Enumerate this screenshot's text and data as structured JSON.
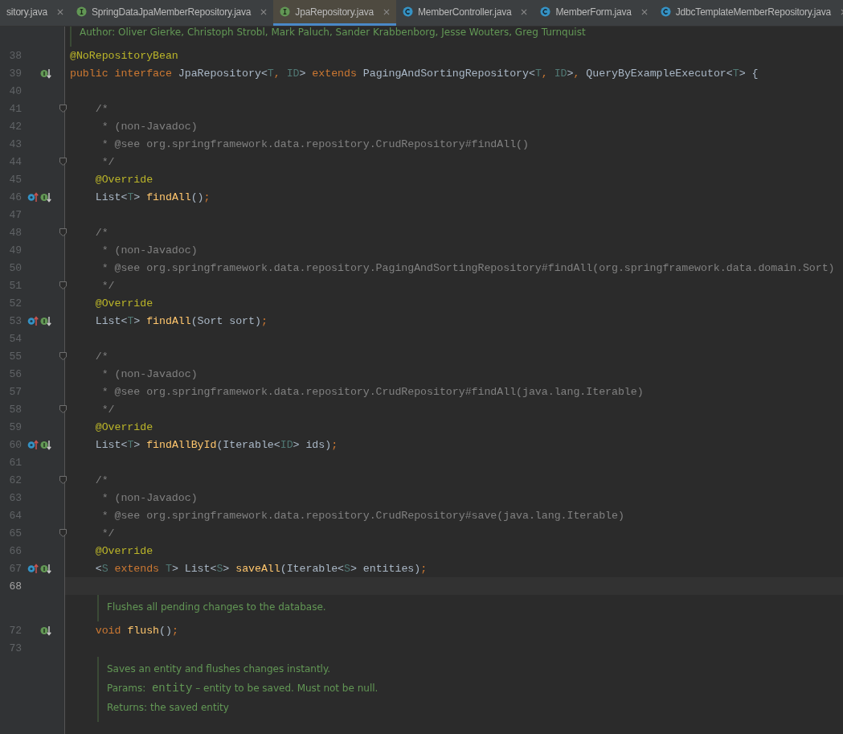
{
  "tabs": [
    {
      "label": "sitory.java",
      "selected": false
    },
    {
      "label": "SpringDataJpaMemberRepository.java",
      "kind": "interface",
      "selected": false
    },
    {
      "label": "JpaRepository.java",
      "kind": "interface",
      "selected": true
    },
    {
      "label": "MemberController.java",
      "kind": "class",
      "selected": false
    },
    {
      "label": "MemberForm.java",
      "kind": "class",
      "selected": false
    },
    {
      "label": "JdbcTemplateMemberRepository.java",
      "kind": "class",
      "selected": false
    }
  ],
  "lines": [
    {
      "kind": "doc",
      "rows": [
        {
          "kind": "text",
          "text": "Author: Oliver Gierke, Christoph Strobl, Mark Paluch, Sander Krabbenborg, Jesse Wouters, Greg Turnquist"
        }
      ]
    },
    {
      "kind": "code",
      "number": "38",
      "fold": false,
      "current": false,
      "tokens": [
        {
          "kind": "ann",
          "t": "@NoRepositoryBean"
        }
      ]
    },
    {
      "kind": "code",
      "number": "39",
      "markers": [
        {
          "kind": "implemented"
        }
      ],
      "fold": false,
      "current": false,
      "tokens": [
        {
          "kind": "kw",
          "t": "public interface "
        },
        {
          "kind": "pl",
          "t": "JpaRepository<"
        },
        {
          "kind": "tp",
          "t": "T"
        },
        {
          "kind": "kw",
          "t": ", "
        },
        {
          "kind": "tp",
          "t": "ID"
        },
        {
          "kind": "pl",
          "t": "> "
        },
        {
          "kind": "kw",
          "t": "extends "
        },
        {
          "kind": "pl",
          "t": "PagingAndSortingRepository<"
        },
        {
          "kind": "tp",
          "t": "T"
        },
        {
          "kind": "kw",
          "t": ", "
        },
        {
          "kind": "tp",
          "t": "ID"
        },
        {
          "kind": "pl",
          "t": ">"
        },
        {
          "kind": "kw",
          "t": ", "
        },
        {
          "kind": "pl",
          "t": "QueryByExampleExecutor<"
        },
        {
          "kind": "tp",
          "t": "T"
        },
        {
          "kind": "pl",
          "t": "> {"
        }
      ]
    },
    {
      "kind": "code",
      "number": "40",
      "fold": false,
      "current": false
    },
    {
      "kind": "code",
      "number": "41",
      "fold": true,
      "current": false,
      "tokens": [
        {
          "kind": "cm",
          "t": "    /*"
        }
      ]
    },
    {
      "kind": "code",
      "number": "42",
      "fold": false,
      "current": false,
      "tokens": [
        {
          "kind": "cm",
          "t": "     * (non-Javadoc)"
        }
      ]
    },
    {
      "kind": "code",
      "number": "43",
      "fold": false,
      "current": false,
      "tokens": [
        {
          "kind": "cm",
          "t": "     * @see org.springframework.data.repository.CrudRepository#findAll()"
        }
      ]
    },
    {
      "kind": "code",
      "number": "44",
      "fold": true,
      "current": false,
      "tokens": [
        {
          "kind": "cm",
          "t": "     */"
        }
      ]
    },
    {
      "kind": "code",
      "number": "45",
      "fold": false,
      "current": false,
      "tokens": [
        {
          "kind": "ann",
          "t": "    @Override"
        }
      ]
    },
    {
      "kind": "code",
      "number": "46",
      "markers": [
        {
          "kind": "overrides"
        },
        {
          "kind": "implemented"
        }
      ],
      "fold": false,
      "current": false,
      "tokens": [
        {
          "kind": "pl",
          "t": "    List<"
        },
        {
          "kind": "tp",
          "t": "T"
        },
        {
          "kind": "pl",
          "t": "> "
        },
        {
          "kind": "fn",
          "t": "findAll"
        },
        {
          "kind": "pl",
          "t": "()"
        },
        {
          "kind": "kw",
          "t": ";"
        }
      ]
    },
    {
      "kind": "code",
      "number": "47",
      "fold": false,
      "current": false
    },
    {
      "kind": "code",
      "number": "48",
      "fold": true,
      "current": false,
      "tokens": [
        {
          "kind": "cm",
          "t": "    /*"
        }
      ]
    },
    {
      "kind": "code",
      "number": "49",
      "fold": false,
      "current": false,
      "tokens": [
        {
          "kind": "cm",
          "t": "     * (non-Javadoc)"
        }
      ]
    },
    {
      "kind": "code",
      "number": "50",
      "fold": false,
      "current": false,
      "tokens": [
        {
          "kind": "cm",
          "t": "     * @see org.springframework.data.repository.PagingAndSortingRepository#findAll(org.springframework.data.domain.Sort)"
        }
      ]
    },
    {
      "kind": "code",
      "number": "51",
      "fold": true,
      "current": false,
      "tokens": [
        {
          "kind": "cm",
          "t": "     */"
        }
      ]
    },
    {
      "kind": "code",
      "number": "52",
      "fold": false,
      "current": false,
      "tokens": [
        {
          "kind": "ann",
          "t": "    @Override"
        }
      ]
    },
    {
      "kind": "code",
      "number": "53",
      "markers": [
        {
          "kind": "overrides"
        },
        {
          "kind": "implemented"
        }
      ],
      "fold": false,
      "current": false,
      "tokens": [
        {
          "kind": "pl",
          "t": "    List<"
        },
        {
          "kind": "tp",
          "t": "T"
        },
        {
          "kind": "pl",
          "t": "> "
        },
        {
          "kind": "fn",
          "t": "findAll"
        },
        {
          "kind": "pl",
          "t": "(Sort sort)"
        },
        {
          "kind": "kw",
          "t": ";"
        }
      ]
    },
    {
      "kind": "code",
      "number": "54",
      "fold": false,
      "current": false
    },
    {
      "kind": "code",
      "number": "55",
      "fold": true,
      "current": false,
      "tokens": [
        {
          "kind": "cm",
          "t": "    /*"
        }
      ]
    },
    {
      "kind": "code",
      "number": "56",
      "fold": false,
      "current": false,
      "tokens": [
        {
          "kind": "cm",
          "t": "     * (non-Javadoc)"
        }
      ]
    },
    {
      "kind": "code",
      "number": "57",
      "fold": false,
      "current": false,
      "tokens": [
        {
          "kind": "cm",
          "t": "     * @see org.springframework.data.repository.CrudRepository#findAll(java.lang.Iterable)"
        }
      ]
    },
    {
      "kind": "code",
      "number": "58",
      "fold": true,
      "current": false,
      "tokens": [
        {
          "kind": "cm",
          "t": "     */"
        }
      ]
    },
    {
      "kind": "code",
      "number": "59",
      "fold": false,
      "current": false,
      "tokens": [
        {
          "kind": "ann",
          "t": "    @Override"
        }
      ]
    },
    {
      "kind": "code",
      "number": "60",
      "markers": [
        {
          "kind": "overrides"
        },
        {
          "kind": "implemented"
        }
      ],
      "fold": false,
      "current": false,
      "tokens": [
        {
          "kind": "pl",
          "t": "    List<"
        },
        {
          "kind": "tp",
          "t": "T"
        },
        {
          "kind": "pl",
          "t": "> "
        },
        {
          "kind": "fn",
          "t": "findAllById"
        },
        {
          "kind": "pl",
          "t": "(Iterable<"
        },
        {
          "kind": "tp",
          "t": "ID"
        },
        {
          "kind": "pl",
          "t": "> ids)"
        },
        {
          "kind": "kw",
          "t": ";"
        }
      ]
    },
    {
      "kind": "code",
      "number": "61",
      "fold": false,
      "current": false
    },
    {
      "kind": "code",
      "number": "62",
      "fold": true,
      "current": false,
      "tokens": [
        {
          "kind": "cm",
          "t": "    /*"
        }
      ]
    },
    {
      "kind": "code",
      "number": "63",
      "fold": false,
      "current": false,
      "tokens": [
        {
          "kind": "cm",
          "t": "     * (non-Javadoc)"
        }
      ]
    },
    {
      "kind": "code",
      "number": "64",
      "fold": false,
      "current": false,
      "tokens": [
        {
          "kind": "cm",
          "t": "     * @see org.springframework.data.repository.CrudRepository#save(java.lang.Iterable)"
        }
      ]
    },
    {
      "kind": "code",
      "number": "65",
      "fold": true,
      "current": false,
      "tokens": [
        {
          "kind": "cm",
          "t": "     */"
        }
      ]
    },
    {
      "kind": "code",
      "number": "66",
      "fold": false,
      "current": false,
      "tokens": [
        {
          "kind": "ann",
          "t": "    @Override"
        }
      ]
    },
    {
      "kind": "code",
      "number": "67",
      "markers": [
        {
          "kind": "overrides"
        },
        {
          "kind": "implemented"
        }
      ],
      "fold": false,
      "current": false,
      "tokens": [
        {
          "kind": "pl",
          "t": "    <"
        },
        {
          "kind": "tp",
          "t": "S"
        },
        {
          "kind": "kw",
          "t": " extends "
        },
        {
          "kind": "tp",
          "t": "T"
        },
        {
          "kind": "pl",
          "t": "> List<"
        },
        {
          "kind": "tp",
          "t": "S"
        },
        {
          "kind": "pl",
          "t": "> "
        },
        {
          "kind": "fn",
          "t": "saveAll"
        },
        {
          "kind": "pl",
          "t": "(Iterable<"
        },
        {
          "kind": "tp",
          "t": "S"
        },
        {
          "kind": "pl",
          "t": "> entities)"
        },
        {
          "kind": "kw",
          "t": ";"
        }
      ]
    },
    {
      "kind": "code",
      "number": "68",
      "fold": false,
      "current": true
    },
    {
      "kind": "doc",
      "rows": [
        {
          "kind": "text",
          "text": "Flushes all pending changes to the database."
        }
      ]
    },
    {
      "kind": "code",
      "number": "72",
      "markers": [
        {
          "kind": "implemented"
        }
      ],
      "fold": false,
      "current": false,
      "tokens": [
        {
          "kind": "kw",
          "t": "    void "
        },
        {
          "kind": "fn",
          "t": "flush"
        },
        {
          "kind": "pl",
          "t": "()"
        },
        {
          "kind": "kw",
          "t": ";"
        }
      ]
    },
    {
      "kind": "code",
      "number": "73",
      "fold": false,
      "current": false
    },
    {
      "kind": "doc",
      "rows": [
        {
          "kind": "text",
          "text": "Saves an entity and flushes changes instantly."
        },
        {
          "kind": "param",
          "label": "Params:",
          "name": "entity",
          "text": "– entity to be saved. Must not be null."
        },
        {
          "kind": "text",
          "text": "Returns: the saved entity"
        }
      ]
    }
  ]
}
